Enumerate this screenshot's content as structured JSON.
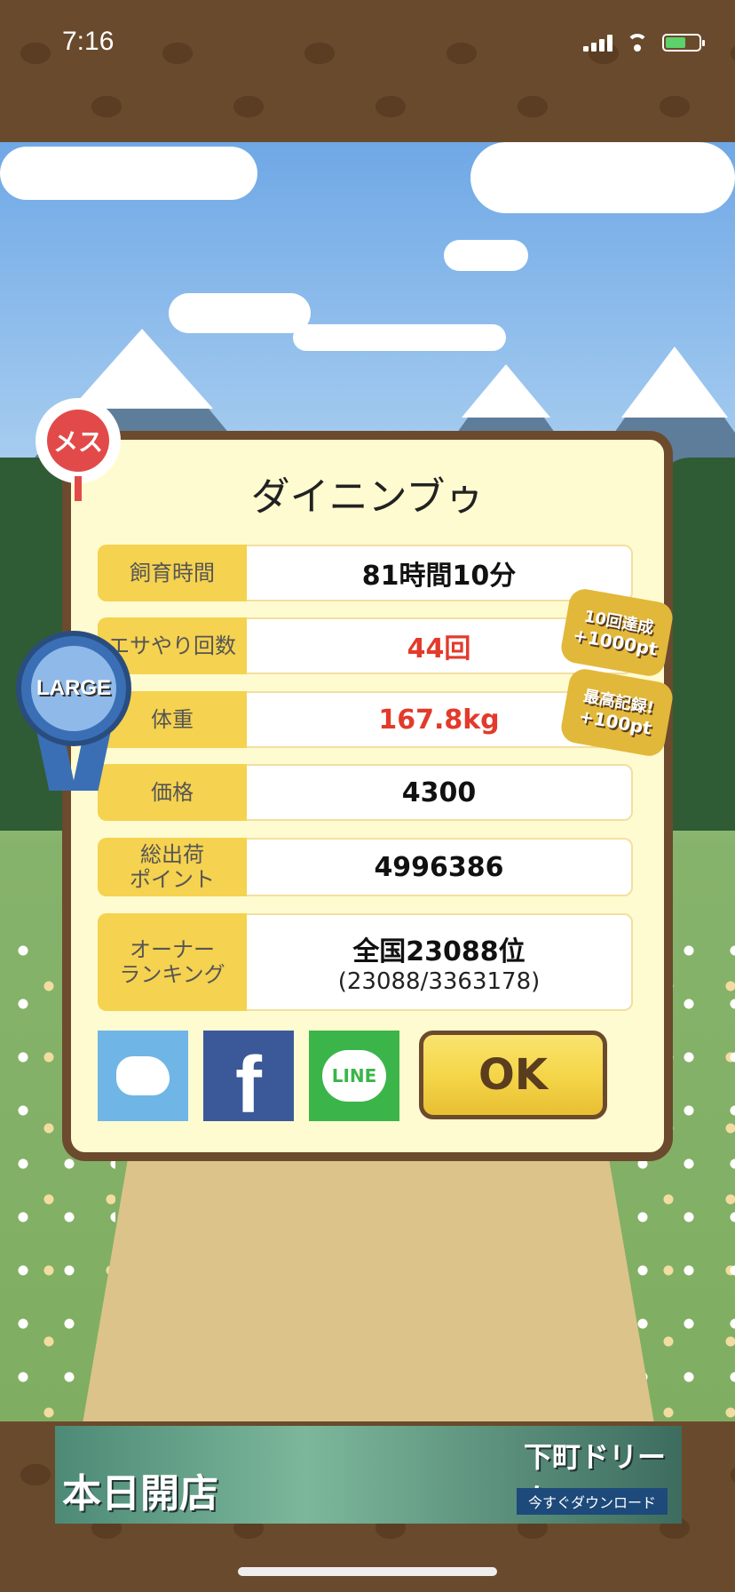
{
  "status_bar": {
    "time": "7:16",
    "battery_color": "#5dd16a"
  },
  "dialog": {
    "title": "ダイニンブゥ",
    "rows": [
      {
        "label": "飼育時間",
        "value": "81時間10分"
      },
      {
        "label": "エサやり回数",
        "value": "44回",
        "value_color": "#e33a2b"
      },
      {
        "label": "体重",
        "value": "167.8kg",
        "value_color": "#e33a2b"
      },
      {
        "label": "価格",
        "value": "4300"
      },
      {
        "label": "総出荷\nポイント",
        "value": "4996386"
      },
      {
        "label": "オーナー\nランキング",
        "value": "全国23088位",
        "sub": "(23088/3363178)"
      }
    ],
    "ok_label": "OK"
  },
  "badges": {
    "gender": "メス",
    "size": "LARGE",
    "bonus_1": {
      "line1": "10回達成",
      "line2": "+1000pt"
    },
    "bonus_2": {
      "line1": "最高記録!",
      "line2": "+100pt"
    }
  },
  "social": {
    "twitter_icon": "twitter-icon",
    "facebook_icon": "facebook-icon",
    "facebook_glyph": "f",
    "line_label": "LINE"
  },
  "ad": {
    "left_text": "本日開店",
    "right_title": "下町ドリーム",
    "right_button": "今すぐダウンロード"
  }
}
